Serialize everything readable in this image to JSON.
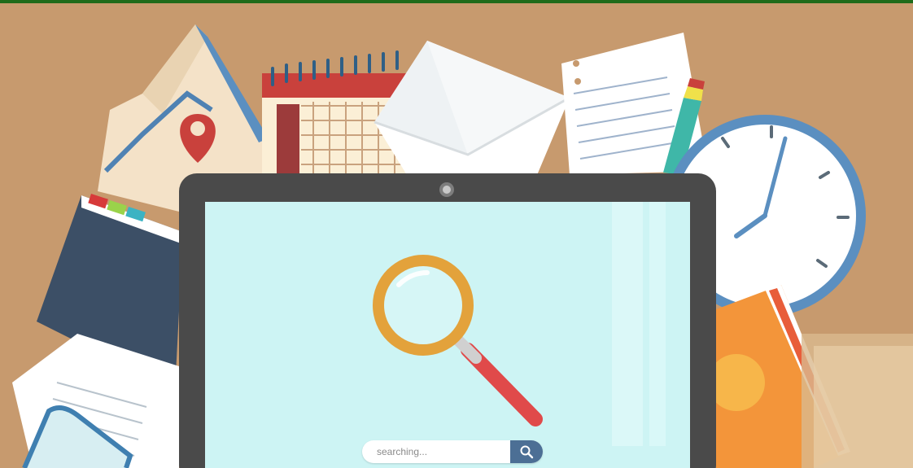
{
  "search": {
    "placeholder": "searching...",
    "icon": "search-icon"
  },
  "colors": {
    "background": "#c79a6e",
    "top_bar": "#1f6b1a",
    "laptop_bezel": "#4a4a4a",
    "screen": "#cdf4f4",
    "magnifier_ring": "#e3a23b",
    "magnifier_handle": "#e04a4a",
    "search_button": "#4c6f95"
  }
}
